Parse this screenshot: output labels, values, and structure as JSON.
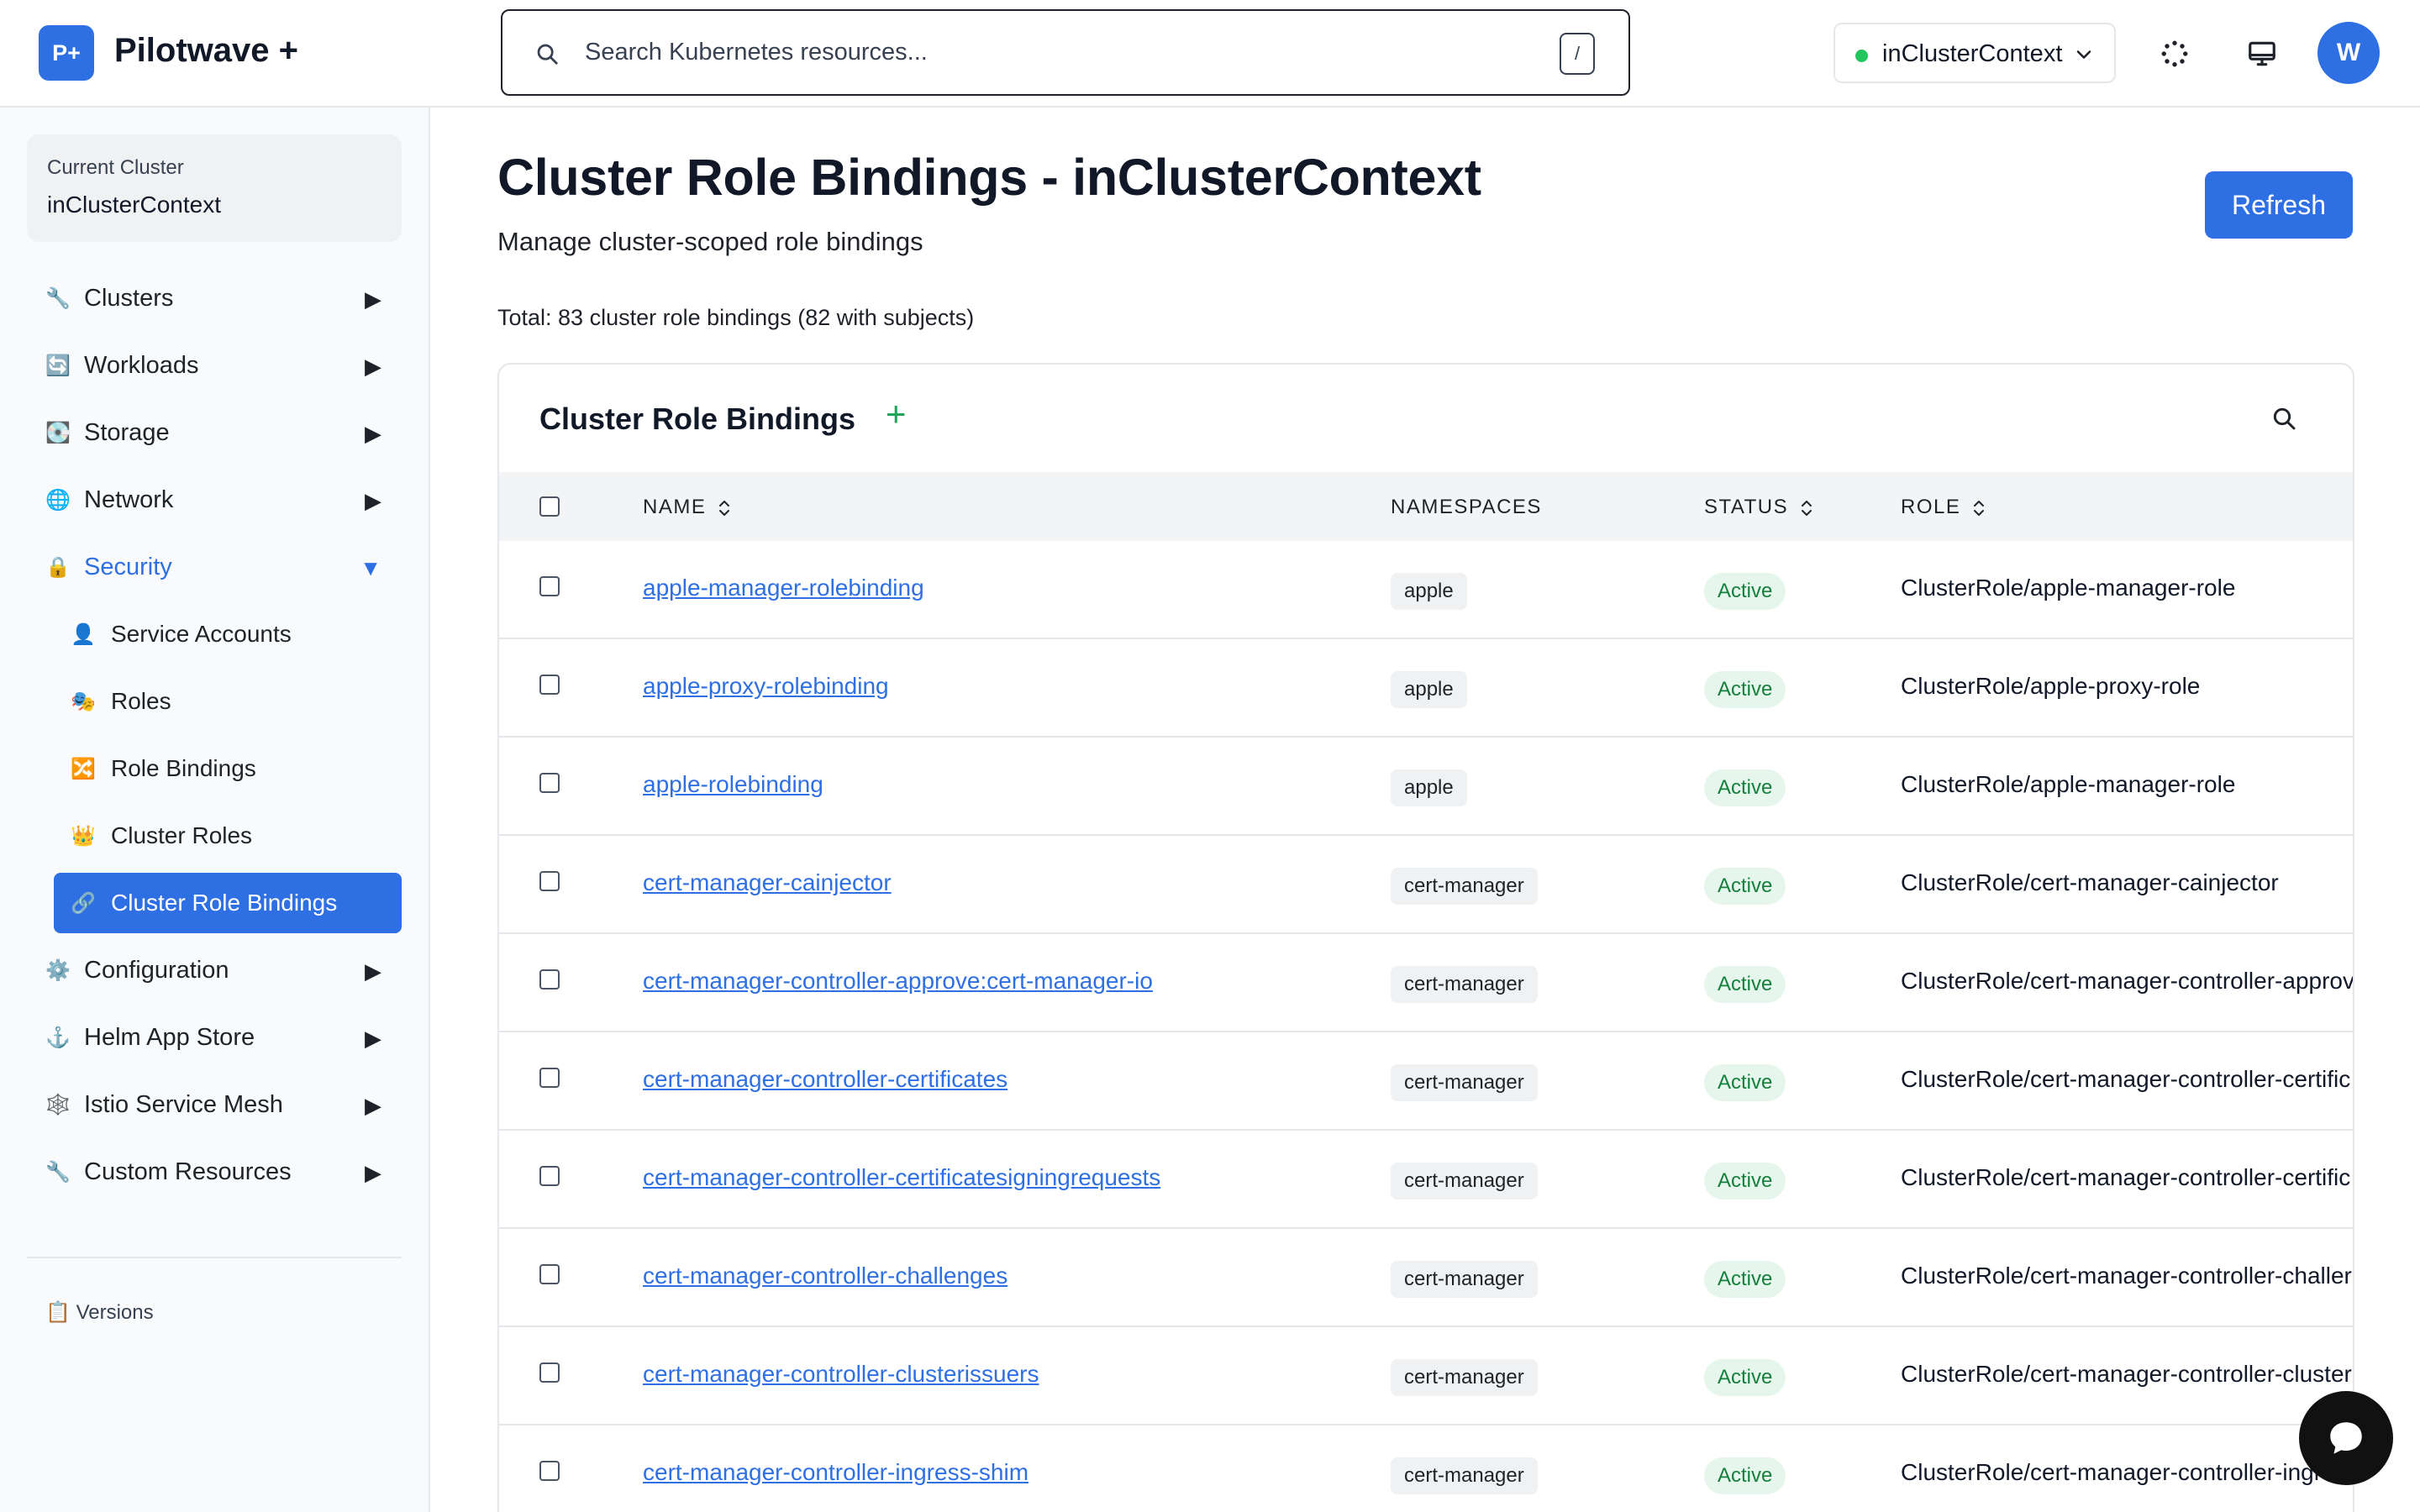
{
  "header": {
    "logo_text": "P+",
    "brand": "Pilotwave +",
    "search_placeholder": "Search Kubernetes resources...",
    "search_shortcut": "/",
    "context_label": "inClusterContext",
    "avatar_initial": "W"
  },
  "sidebar": {
    "current_cluster_label": "Current Cluster",
    "current_cluster_value": "inClusterContext",
    "items": [
      {
        "icon": "🔧",
        "label": "Clusters",
        "arrow": "▶"
      },
      {
        "icon": "🔄",
        "label": "Workloads",
        "arrow": "▶"
      },
      {
        "icon": "💽",
        "label": "Storage",
        "arrow": "▶"
      },
      {
        "icon": "🌐",
        "label": "Network",
        "arrow": "▶"
      },
      {
        "icon": "🔒",
        "label": "Security",
        "arrow": "▼"
      },
      {
        "icon": "⚙️",
        "label": "Configuration",
        "arrow": "▶"
      },
      {
        "icon": "⚓",
        "label": "Helm App Store",
        "arrow": "▶"
      },
      {
        "icon": "🕸️",
        "label": "Istio Service Mesh",
        "arrow": "▶"
      },
      {
        "icon": "🔧",
        "label": "Custom Resources",
        "arrow": "▶"
      }
    ],
    "security_children": [
      {
        "icon": "👤",
        "label": "Service Accounts"
      },
      {
        "icon": "🎭",
        "label": "Roles"
      },
      {
        "icon": "🔀",
        "label": "Role Bindings"
      },
      {
        "icon": "👑",
        "label": "Cluster Roles"
      },
      {
        "icon": "🔗",
        "label": "Cluster Role Bindings"
      }
    ],
    "versions_icon": "📋",
    "versions_label": "Versions"
  },
  "main": {
    "title": "Cluster Role Bindings - inClusterContext",
    "subtitle": "Manage cluster-scoped role bindings",
    "refresh_label": "Refresh",
    "total_text": "Total: 83 cluster role bindings (82 with subjects)",
    "card_title": "Cluster Role Bindings",
    "add_symbol": "+",
    "columns": {
      "name": "NAME",
      "namespaces": "NAMESPACES",
      "status": "STATUS",
      "role": "ROLE"
    },
    "rows": [
      {
        "name": "apple-manager-rolebinding",
        "namespace": "apple",
        "status": "Active",
        "role": "ClusterRole/apple-manager-role"
      },
      {
        "name": "apple-proxy-rolebinding",
        "namespace": "apple",
        "status": "Active",
        "role": "ClusterRole/apple-proxy-role"
      },
      {
        "name": "apple-rolebinding",
        "namespace": "apple",
        "status": "Active",
        "role": "ClusterRole/apple-manager-role"
      },
      {
        "name": "cert-manager-cainjector",
        "namespace": "cert-manager",
        "status": "Active",
        "role": "ClusterRole/cert-manager-cainjector"
      },
      {
        "name": "cert-manager-controller-approve:cert-manager-io",
        "namespace": "cert-manager",
        "status": "Active",
        "role": "ClusterRole/cert-manager-controller-approv"
      },
      {
        "name": "cert-manager-controller-certificates",
        "namespace": "cert-manager",
        "status": "Active",
        "role": "ClusterRole/cert-manager-controller-certific"
      },
      {
        "name": "cert-manager-controller-certificatesigningrequests",
        "namespace": "cert-manager",
        "status": "Active",
        "role": "ClusterRole/cert-manager-controller-certific"
      },
      {
        "name": "cert-manager-controller-challenges",
        "namespace": "cert-manager",
        "status": "Active",
        "role": "ClusterRole/cert-manager-controller-challer"
      },
      {
        "name": "cert-manager-controller-clusterissuers",
        "namespace": "cert-manager",
        "status": "Active",
        "role": "ClusterRole/cert-manager-controller-cluster"
      },
      {
        "name": "cert-manager-controller-ingress-shim",
        "namespace": "cert-manager",
        "status": "Active",
        "role": "ClusterRole/cert-manager-controller-ingr"
      }
    ]
  }
}
